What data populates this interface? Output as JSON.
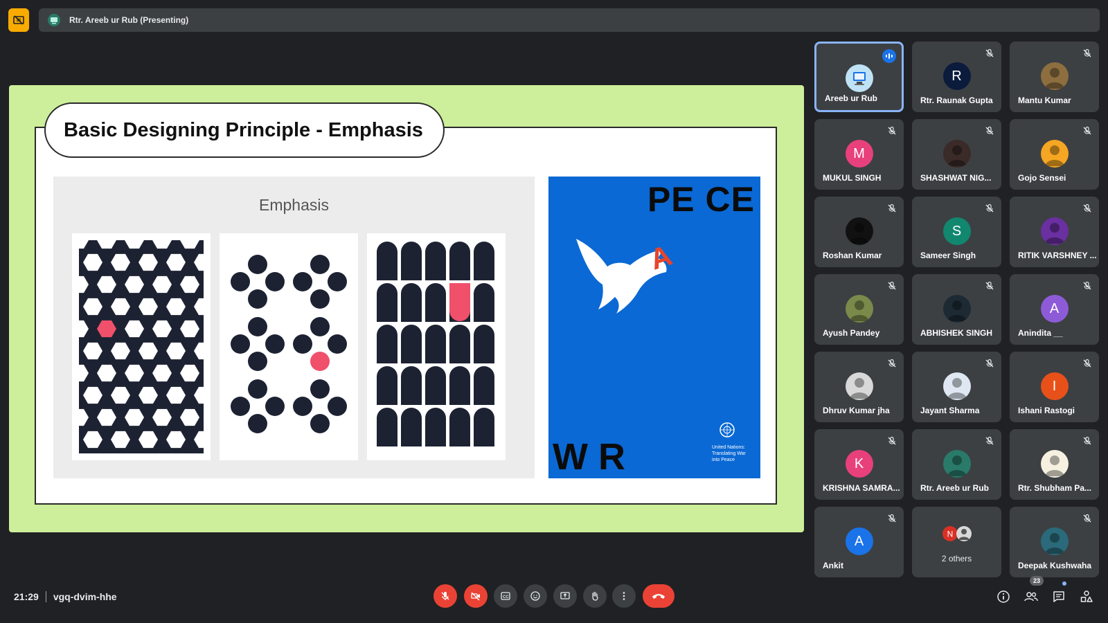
{
  "header": {
    "presenter_label": "Rtr. Areeb ur Rub (Presenting)"
  },
  "slide": {
    "title": "Basic Designing Principle - Emphasis",
    "emphasis_label": "Emphasis",
    "poster": {
      "top_text": "PE  CE",
      "bottom_text": "W  R",
      "accent_letter": "A",
      "un_text": "United Nations: Translating War into Peace",
      "accent_color": "#e8442a",
      "bg_color": "#0a69d4"
    },
    "accent_color": "#f0506a",
    "shape_color": "#1d2233"
  },
  "participants": [
    {
      "name": "Areeb ur Rub",
      "avatar": "computer-avatar",
      "speaking": true
    },
    {
      "name": "Rtr. Raunak Gupta",
      "avatar": "R",
      "color": "#0b1b3c"
    },
    {
      "name": "Mantu Kumar",
      "avatar": "photo",
      "color": "#8d6e3f"
    },
    {
      "name": "MUKUL SINGH",
      "avatar": "M",
      "color": "#e8407a"
    },
    {
      "name": "SHASHWAT NIG...",
      "avatar": "photo",
      "color": "#3a2a28"
    },
    {
      "name": "Gojo Sensei",
      "avatar": "photo",
      "color": "#f5a623"
    },
    {
      "name": "Roshan Kumar",
      "avatar": "photo",
      "color": "#111111"
    },
    {
      "name": "Sameer Singh",
      "avatar": "S",
      "color": "#12876f"
    },
    {
      "name": "RITIK VARSHNEY ...",
      "avatar": "photo",
      "color": "#6a2fa0"
    },
    {
      "name": "Ayush Pandey",
      "avatar": "photo",
      "color": "#7a8a4a"
    },
    {
      "name": "ABHISHEK SINGH",
      "avatar": "photo",
      "color": "#1d2a33"
    },
    {
      "name": "Anindita __",
      "avatar": "A",
      "color": "#8e5bd8"
    },
    {
      "name": "Dhruv Kumar jha",
      "avatar": "photo",
      "color": "#d8d8d8"
    },
    {
      "name": "Jayant Sharma",
      "avatar": "photo",
      "color": "#dfe8f2"
    },
    {
      "name": "Ishani Rastogi",
      "avatar": "I",
      "color": "#e8501a"
    },
    {
      "name": "KRISHNA SAMRA...",
      "avatar": "K",
      "color": "#e8407a"
    },
    {
      "name": "Rtr. Areeb ur Rub",
      "avatar": "photo",
      "color": "#2a7a6a"
    },
    {
      "name": "Rtr. Shubham Pa...",
      "avatar": "photo",
      "color": "#f5f0e0"
    },
    {
      "name": "Ankit",
      "avatar": "A",
      "color": "#1a73e8"
    },
    {
      "name": "2 others",
      "avatar": "N",
      "color": "#d93025"
    },
    {
      "name": "Deepak Kushwaha",
      "avatar": "photo",
      "color": "#2a6a7a"
    }
  ],
  "bottom_bar": {
    "time": "21:29",
    "meeting_code": "vgq-dvim-hhe",
    "people_count": "23"
  }
}
